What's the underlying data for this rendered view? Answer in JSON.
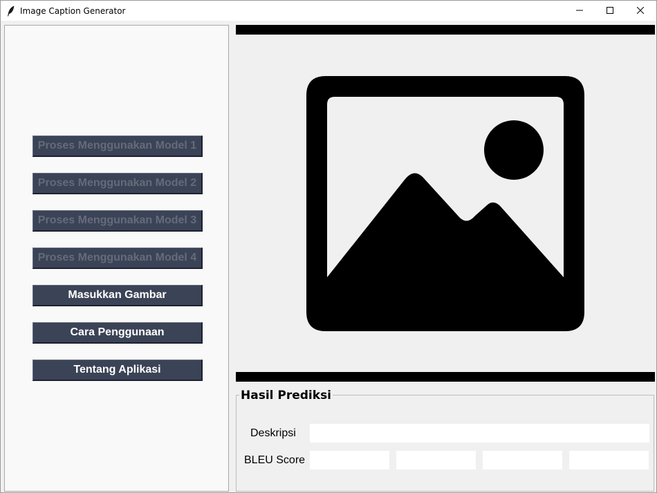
{
  "window": {
    "title": "Image Caption Generator",
    "icon": "feather-icon",
    "controls": [
      "minimize-icon",
      "maximize-icon",
      "close-icon"
    ]
  },
  "sidebar": {
    "buttons": [
      {
        "label": "Proses Menggunakan Model 1",
        "enabled": false
      },
      {
        "label": "Proses Menggunakan Model 2",
        "enabled": false
      },
      {
        "label": "Proses Menggunakan Model 3",
        "enabled": false
      },
      {
        "label": "Proses Menggunakan Model 4",
        "enabled": false
      },
      {
        "label": "Masukkan Gambar",
        "enabled": true
      },
      {
        "label": "Cara Penggunaan",
        "enabled": true
      },
      {
        "label": "Tentang Aplikasi",
        "enabled": true
      }
    ]
  },
  "preview": {
    "icon": "image-placeholder-icon"
  },
  "results": {
    "title": "Hasil Prediksi",
    "description_label": "Deskripsi",
    "description_value": "",
    "bleu_label": "BLEU Score",
    "bleu_values": [
      "",
      "",
      "",
      ""
    ]
  },
  "colors": {
    "button_bg": "#3b4356",
    "button_text": "#ffffff",
    "button_text_disabled": "#646b7b",
    "sidebar_bg": "#f9f9f9",
    "window_bg": "#f0f0f0",
    "bar": "#000000"
  }
}
